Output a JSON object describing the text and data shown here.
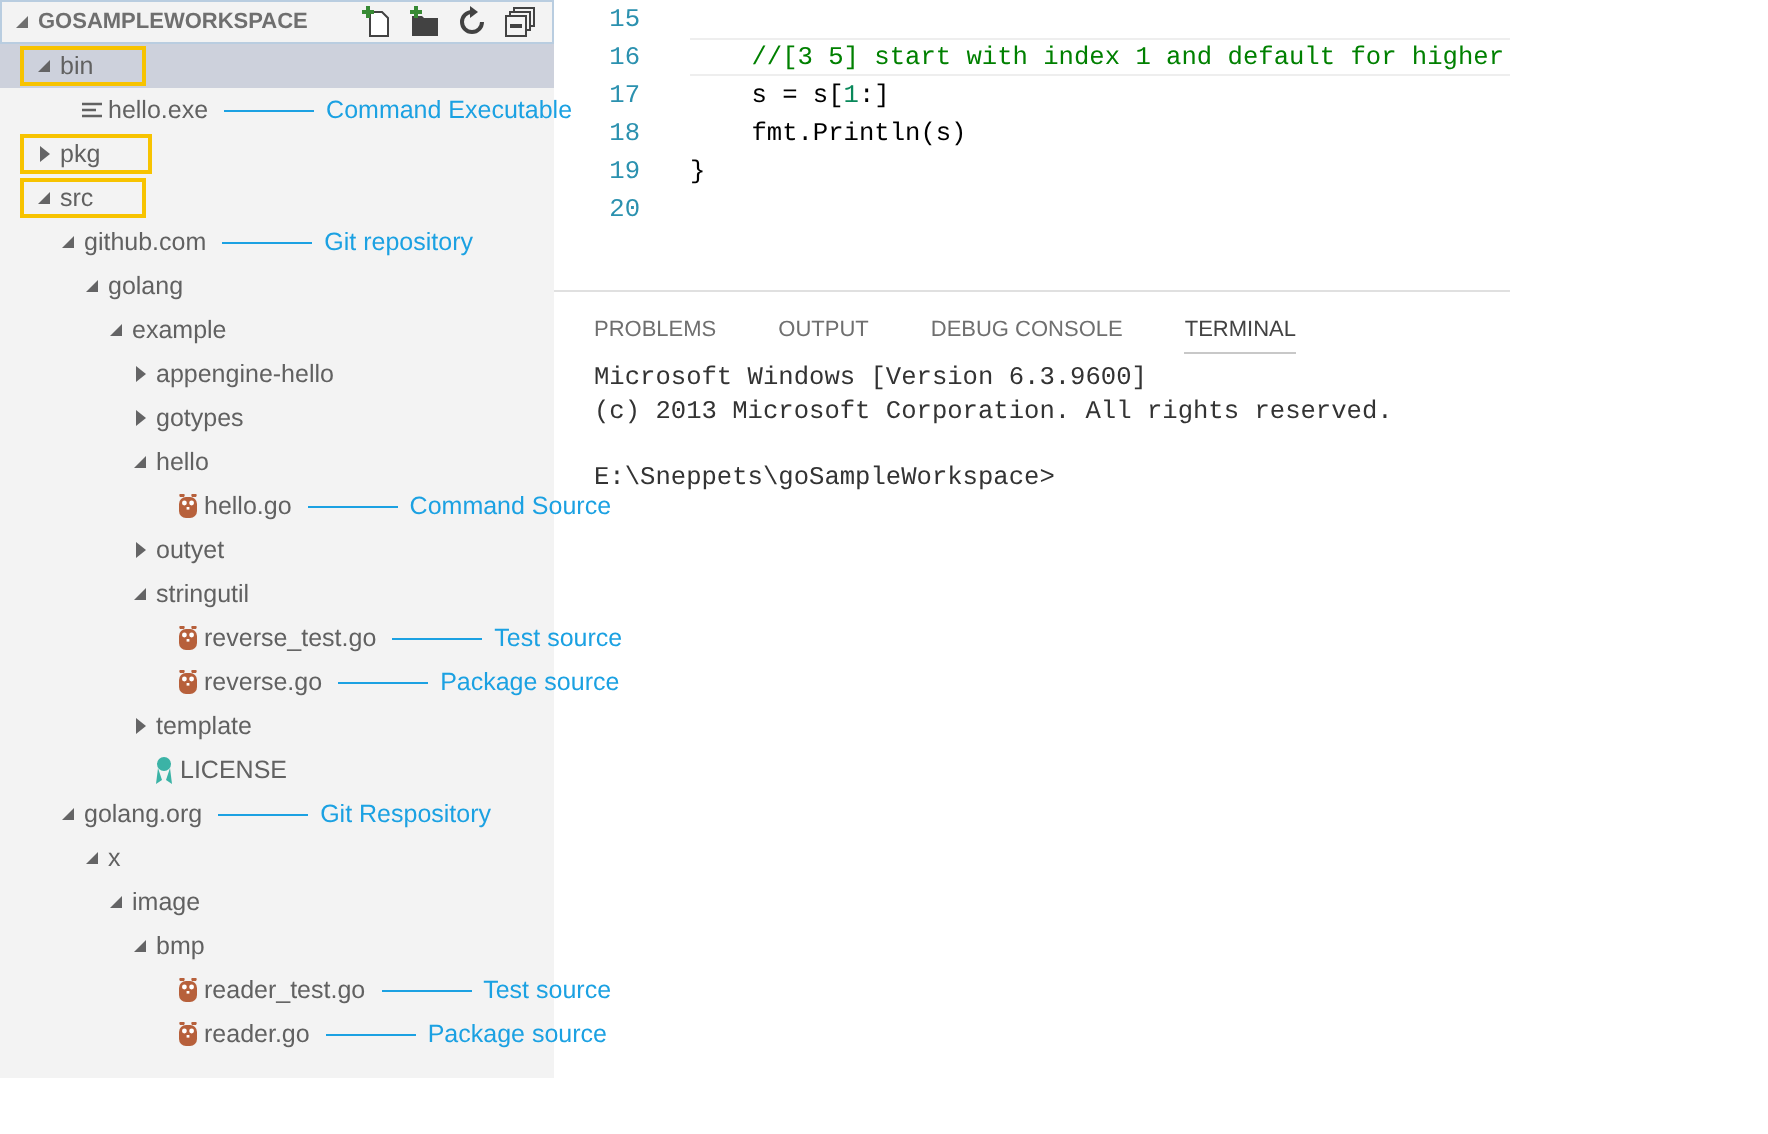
{
  "explorer": {
    "title": "GOSAMPLEWORKSPACE",
    "expanded": true,
    "tree": [
      {
        "label": "bin",
        "kind": "folder",
        "expanded": true,
        "selected": true,
        "highlighted": true,
        "children": [
          {
            "label": "hello.exe",
            "kind": "binary",
            "selected": false,
            "highlighted": false,
            "annotation": "Command Executable"
          }
        ]
      },
      {
        "label": "pkg",
        "kind": "folder",
        "expanded": false,
        "selected": false,
        "highlighted": true
      },
      {
        "label": "src",
        "kind": "folder",
        "expanded": true,
        "selected": false,
        "highlighted": true,
        "children": [
          {
            "label": "github.com",
            "kind": "folder",
            "expanded": true,
            "selected": false,
            "highlighted": false,
            "annotation": "Git repository",
            "children": [
              {
                "label": "golang",
                "kind": "folder",
                "expanded": true,
                "selected": false,
                "highlighted": false,
                "children": [
                  {
                    "label": "example",
                    "kind": "folder",
                    "expanded": true,
                    "selected": false,
                    "highlighted": false,
                    "children": [
                      {
                        "label": "appengine-hello",
                        "kind": "folder",
                        "expanded": false,
                        "selected": false,
                        "highlighted": false
                      },
                      {
                        "label": "gotypes",
                        "kind": "folder",
                        "expanded": false,
                        "selected": false,
                        "highlighted": false
                      },
                      {
                        "label": "hello",
                        "kind": "folder",
                        "expanded": true,
                        "selected": false,
                        "highlighted": false,
                        "children": [
                          {
                            "label": "hello.go",
                            "kind": "go",
                            "selected": false,
                            "highlighted": false,
                            "annotation": "Command Source"
                          }
                        ]
                      },
                      {
                        "label": "outyet",
                        "kind": "folder",
                        "expanded": false,
                        "selected": false,
                        "highlighted": false
                      },
                      {
                        "label": "stringutil",
                        "kind": "folder",
                        "expanded": true,
                        "selected": false,
                        "highlighted": false,
                        "children": [
                          {
                            "label": "reverse_test.go",
                            "kind": "go",
                            "selected": false,
                            "highlighted": false,
                            "annotation": "Test source"
                          },
                          {
                            "label": "reverse.go",
                            "kind": "go",
                            "selected": false,
                            "highlighted": false,
                            "annotation": "Package source"
                          }
                        ]
                      },
                      {
                        "label": "template",
                        "kind": "folder",
                        "expanded": false,
                        "selected": false,
                        "highlighted": false
                      },
                      {
                        "label": "LICENSE",
                        "kind": "license",
                        "selected": false,
                        "highlighted": false
                      }
                    ]
                  }
                ]
              }
            ]
          },
          {
            "label": "golang.org",
            "kind": "folder",
            "expanded": true,
            "selected": false,
            "highlighted": false,
            "annotation": "Git Respository",
            "children": [
              {
                "label": "x",
                "kind": "folder",
                "expanded": true,
                "selected": false,
                "highlighted": false,
                "children": [
                  {
                    "label": "image",
                    "kind": "folder",
                    "expanded": true,
                    "selected": false,
                    "highlighted": false,
                    "children": [
                      {
                        "label": "bmp",
                        "kind": "folder",
                        "expanded": true,
                        "selected": false,
                        "highlighted": false,
                        "children": [
                          {
                            "label": "reader_test.go",
                            "kind": "go",
                            "selected": false,
                            "highlighted": false,
                            "annotation": "Test source"
                          },
                          {
                            "label": "reader.go",
                            "kind": "go",
                            "selected": false,
                            "highlighted": false,
                            "annotation": "Package source"
                          }
                        ]
                      }
                    ]
                  }
                ]
              }
            ]
          }
        ]
      }
    ]
  },
  "editor": {
    "lines": [
      {
        "number": "15",
        "current": false
      },
      {
        "number": "16",
        "current": true,
        "tokens": [
          {
            "kind": "comment",
            "text": "    //[3 5] start with index 1 and default for higher"
          }
        ]
      },
      {
        "number": "17",
        "current": false,
        "tokens": [
          {
            "kind": "plain",
            "text": "    s = s["
          },
          {
            "kind": "number",
            "text": "1"
          },
          {
            "kind": "plain",
            "text": ":]"
          }
        ]
      },
      {
        "number": "18",
        "current": false,
        "tokens": [
          {
            "kind": "plain",
            "text": "    fmt.Println(s)"
          }
        ]
      },
      {
        "number": "19",
        "current": false,
        "tokens": [
          {
            "kind": "plain",
            "text": "}"
          }
        ]
      },
      {
        "number": "20",
        "current": false
      }
    ]
  },
  "panel": {
    "tabs": [
      {
        "label": "PROBLEMS",
        "selected": false
      },
      {
        "label": "OUTPUT",
        "selected": false
      },
      {
        "label": "DEBUG CONSOLE",
        "selected": false
      },
      {
        "label": "TERMINAL",
        "selected": true
      }
    ],
    "terminal_output": [
      "Microsoft Windows [Version 6.3.9600]",
      "(c) 2013 Microsoft Corporation. All rights reserved."
    ],
    "terminal_prompt": "E:\\Sneppets\\goSampleWorkspace>"
  }
}
